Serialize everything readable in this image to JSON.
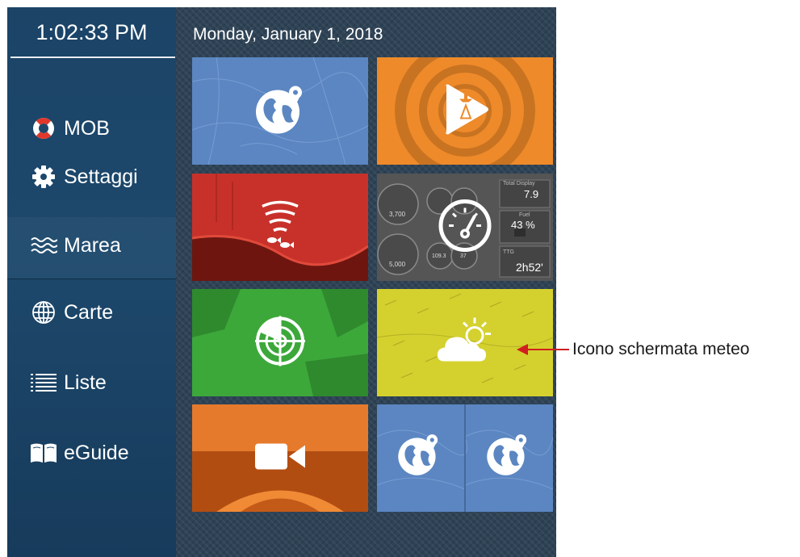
{
  "clock": "1:02:33 PM",
  "date": "Monday, January 1, 2018",
  "menu": [
    {
      "label": "MOB",
      "icon": "lifebuoy-icon"
    },
    {
      "label": "Settaggi",
      "icon": "gear-icon"
    },
    {
      "label": "Marea",
      "icon": "waves-icon"
    },
    {
      "label": "Carte",
      "icon": "globe-icon"
    },
    {
      "label": "Liste",
      "icon": "list-icon"
    },
    {
      "label": "eGuide",
      "icon": "book-icon"
    }
  ],
  "tiles": [
    {
      "name": "chart-plotter",
      "icon": "globe-pin-icon",
      "color": "#5b86c2"
    },
    {
      "name": "autopilot",
      "icon": "play-boat-icon",
      "color": "#ee8a2a"
    },
    {
      "name": "fish-finder",
      "icon": "sonar-fish-icon",
      "color": "#c8312a"
    },
    {
      "name": "instruments",
      "icon": "gauge-icon",
      "color": "#555555",
      "readouts": {
        "total_display": "Total Display",
        "total_value": "7.9",
        "fuel_label": "Fuel",
        "fuel_value": "43 %",
        "ttg_label": "TTG",
        "ttg_value": "2h52'",
        "rpm_1": "3,700",
        "rpm_2": "5,000",
        "gauge_small_1": "109.3",
        "gauge_small_2": "37"
      }
    },
    {
      "name": "radar",
      "icon": "radar-icon",
      "color": "#3ca83a"
    },
    {
      "name": "weather",
      "icon": "weather-icon",
      "color": "#d4d12f"
    },
    {
      "name": "camera",
      "icon": "video-camera-icon",
      "color": "#e06a1f"
    },
    {
      "name": "split-chart",
      "icon": "globe-pin-icon",
      "color": "#5b86c2"
    }
  ],
  "annotation": {
    "label": "Icono schermata meteo",
    "color": "#d01f1f"
  }
}
